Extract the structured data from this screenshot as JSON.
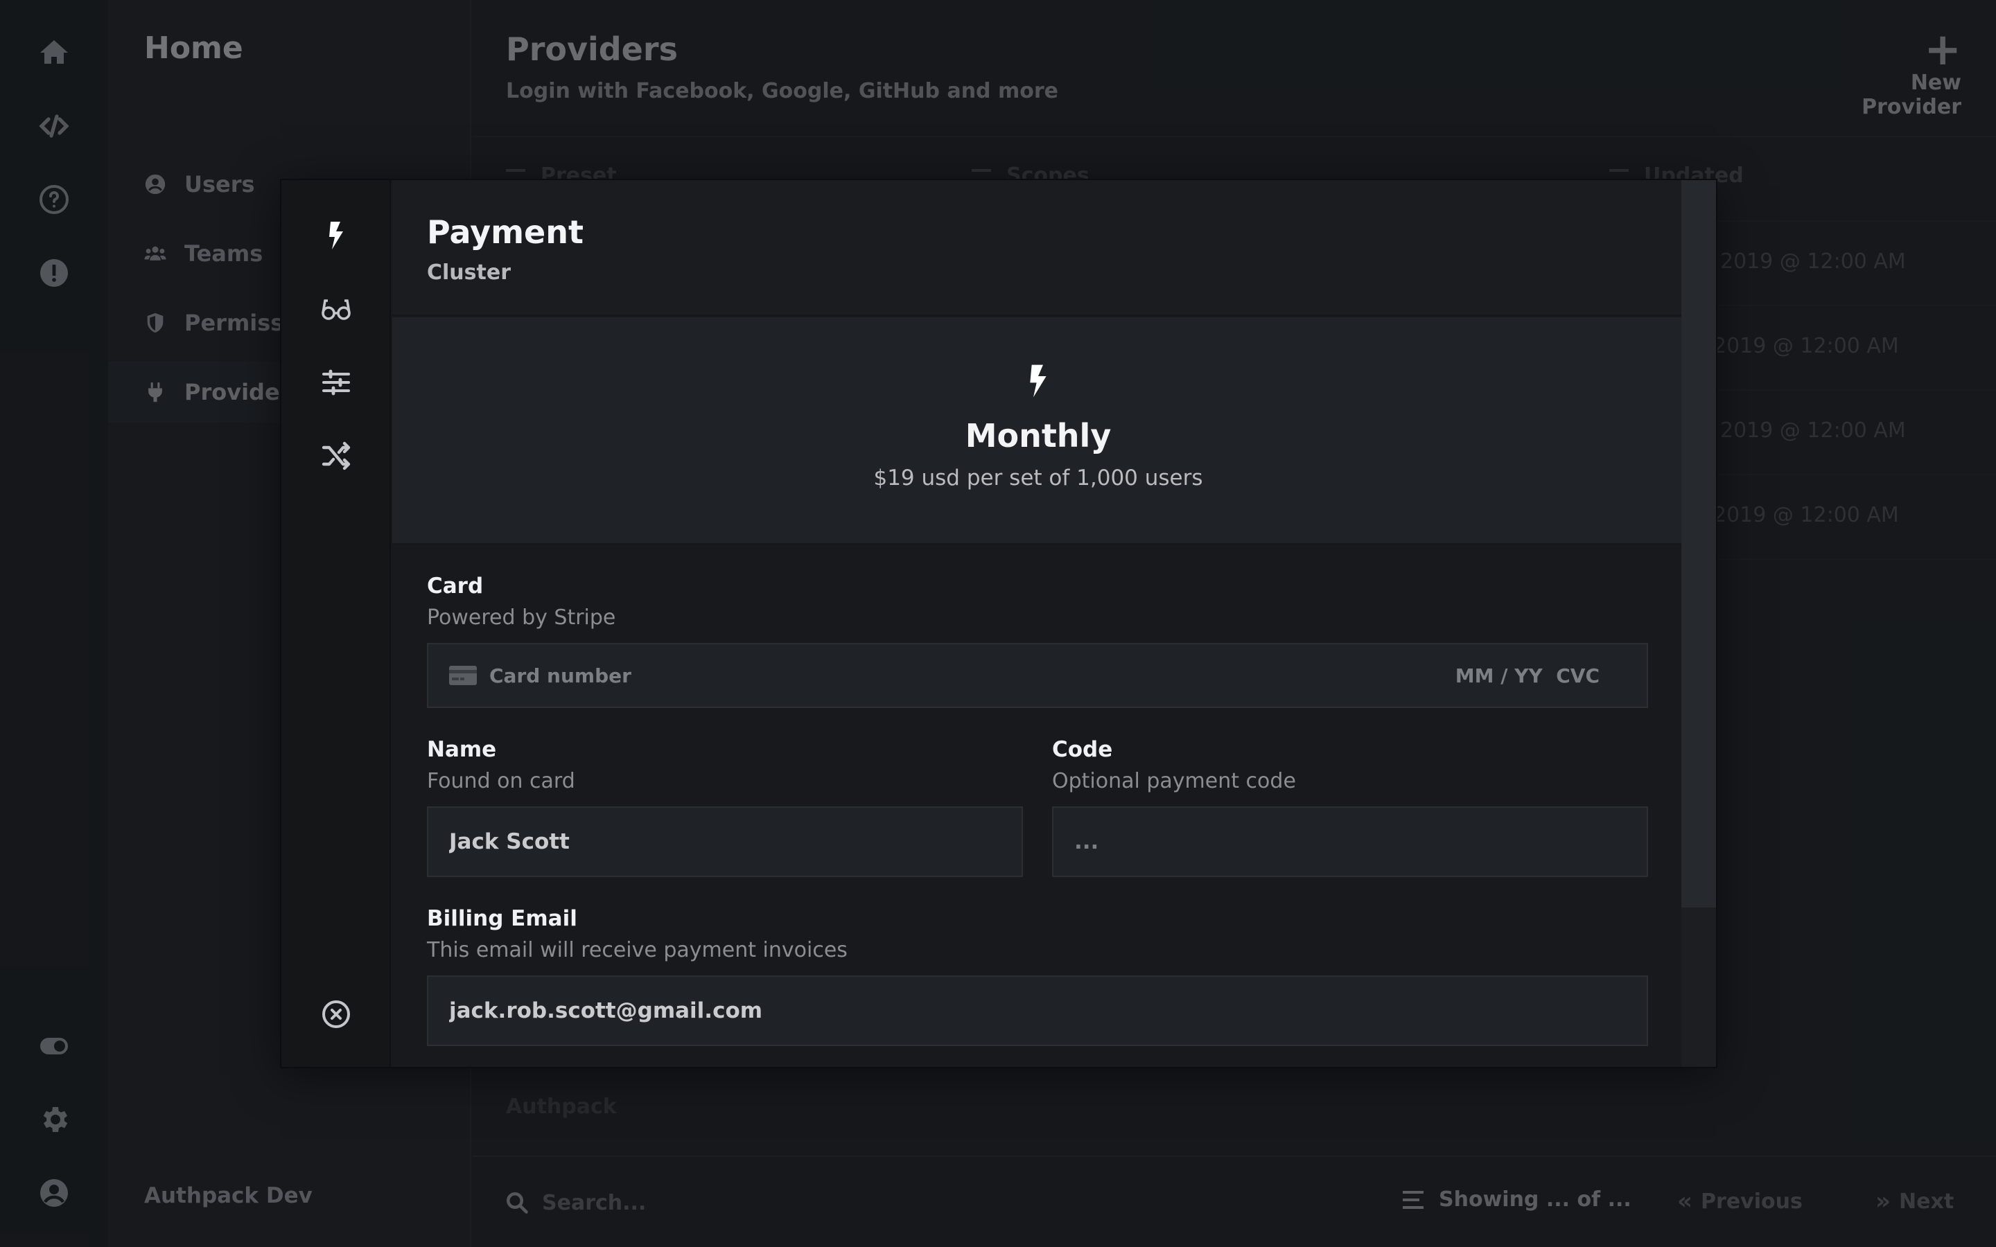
{
  "rail": {
    "top_icons": [
      "home-icon",
      "code-icon",
      "help-icon",
      "alert-icon"
    ],
    "bottom_icons": [
      "toggle-icon",
      "gear-icon",
      "account-icon"
    ]
  },
  "sidebar": {
    "title": "Home",
    "items": [
      {
        "label": "Users",
        "icon": "user-circle-icon"
      },
      {
        "label": "Teams",
        "icon": "users-icon"
      },
      {
        "label": "Permissions",
        "icon": "shield-icon"
      },
      {
        "label": "Providers",
        "icon": "plug-icon",
        "active": true
      }
    ],
    "footer": "Authpack Dev"
  },
  "main": {
    "title": "Providers",
    "subtitle": "Login with Facebook, Google, GitHub and more",
    "new_button": "New Provider",
    "columns": [
      "Preset",
      "Scopes",
      "Updated"
    ],
    "rows_updated": [
      "2019 @ 12:00 AM",
      "2019 @ 12:00 AM",
      "2019 @ 12:00 AM",
      "2019 @ 12:00 AM"
    ],
    "footer_row": "Authpack",
    "search_placeholder": "Search...",
    "showing": "Showing ... of ...",
    "previous": "Previous",
    "next": "Next"
  },
  "modal": {
    "rail_icons": [
      "bolt-icon",
      "glasses-icon",
      "sliders-icon",
      "shuffle-icon",
      "close-circle-icon"
    ],
    "title": "Payment",
    "subtitle": "Cluster",
    "plan": {
      "name": "Monthly",
      "price": "$19 usd per set of 1,000 users"
    },
    "card": {
      "label": "Card",
      "help": "Powered by Stripe",
      "placeholder": "Card number",
      "expiry_cvc": "MM / YY  CVC"
    },
    "name": {
      "label": "Name",
      "help": "Found on card",
      "value": "Jack Scott"
    },
    "code": {
      "label": "Code",
      "help": "Optional payment code",
      "placeholder": "..."
    },
    "email": {
      "label": "Billing Email",
      "help": "This email will receive payment invoices",
      "value": "jack.rob.scott@gmail.com"
    }
  }
}
